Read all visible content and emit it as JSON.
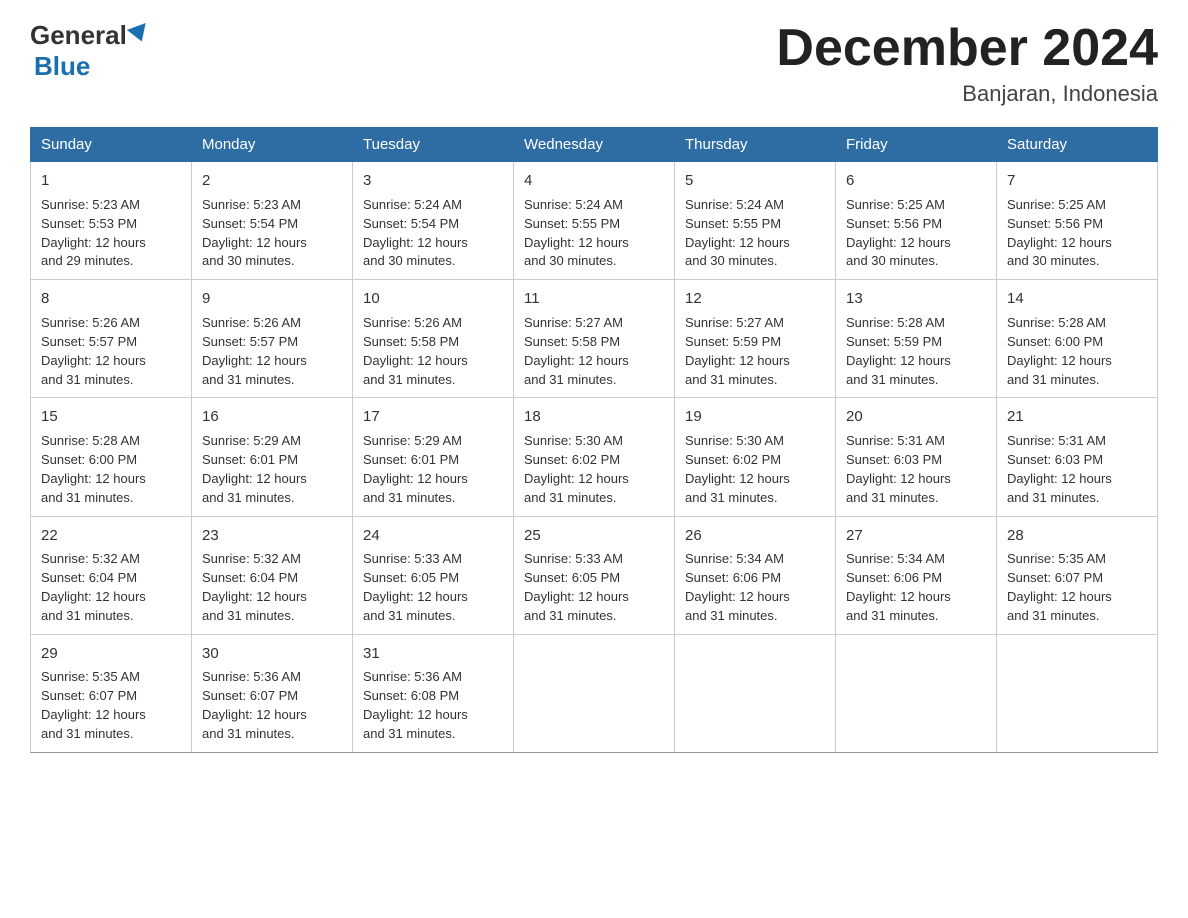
{
  "header": {
    "logo_general": "General",
    "logo_blue": "Blue",
    "month_year": "December 2024",
    "location": "Banjaran, Indonesia"
  },
  "days_of_week": [
    "Sunday",
    "Monday",
    "Tuesday",
    "Wednesday",
    "Thursday",
    "Friday",
    "Saturday"
  ],
  "weeks": [
    [
      {
        "day": "1",
        "lines": [
          "Sunrise: 5:23 AM",
          "Sunset: 5:53 PM",
          "Daylight: 12 hours",
          "and 29 minutes."
        ]
      },
      {
        "day": "2",
        "lines": [
          "Sunrise: 5:23 AM",
          "Sunset: 5:54 PM",
          "Daylight: 12 hours",
          "and 30 minutes."
        ]
      },
      {
        "day": "3",
        "lines": [
          "Sunrise: 5:24 AM",
          "Sunset: 5:54 PM",
          "Daylight: 12 hours",
          "and 30 minutes."
        ]
      },
      {
        "day": "4",
        "lines": [
          "Sunrise: 5:24 AM",
          "Sunset: 5:55 PM",
          "Daylight: 12 hours",
          "and 30 minutes."
        ]
      },
      {
        "day": "5",
        "lines": [
          "Sunrise: 5:24 AM",
          "Sunset: 5:55 PM",
          "Daylight: 12 hours",
          "and 30 minutes."
        ]
      },
      {
        "day": "6",
        "lines": [
          "Sunrise: 5:25 AM",
          "Sunset: 5:56 PM",
          "Daylight: 12 hours",
          "and 30 minutes."
        ]
      },
      {
        "day": "7",
        "lines": [
          "Sunrise: 5:25 AM",
          "Sunset: 5:56 PM",
          "Daylight: 12 hours",
          "and 30 minutes."
        ]
      }
    ],
    [
      {
        "day": "8",
        "lines": [
          "Sunrise: 5:26 AM",
          "Sunset: 5:57 PM",
          "Daylight: 12 hours",
          "and 31 minutes."
        ]
      },
      {
        "day": "9",
        "lines": [
          "Sunrise: 5:26 AM",
          "Sunset: 5:57 PM",
          "Daylight: 12 hours",
          "and 31 minutes."
        ]
      },
      {
        "day": "10",
        "lines": [
          "Sunrise: 5:26 AM",
          "Sunset: 5:58 PM",
          "Daylight: 12 hours",
          "and 31 minutes."
        ]
      },
      {
        "day": "11",
        "lines": [
          "Sunrise: 5:27 AM",
          "Sunset: 5:58 PM",
          "Daylight: 12 hours",
          "and 31 minutes."
        ]
      },
      {
        "day": "12",
        "lines": [
          "Sunrise: 5:27 AM",
          "Sunset: 5:59 PM",
          "Daylight: 12 hours",
          "and 31 minutes."
        ]
      },
      {
        "day": "13",
        "lines": [
          "Sunrise: 5:28 AM",
          "Sunset: 5:59 PM",
          "Daylight: 12 hours",
          "and 31 minutes."
        ]
      },
      {
        "day": "14",
        "lines": [
          "Sunrise: 5:28 AM",
          "Sunset: 6:00 PM",
          "Daylight: 12 hours",
          "and 31 minutes."
        ]
      }
    ],
    [
      {
        "day": "15",
        "lines": [
          "Sunrise: 5:28 AM",
          "Sunset: 6:00 PM",
          "Daylight: 12 hours",
          "and 31 minutes."
        ]
      },
      {
        "day": "16",
        "lines": [
          "Sunrise: 5:29 AM",
          "Sunset: 6:01 PM",
          "Daylight: 12 hours",
          "and 31 minutes."
        ]
      },
      {
        "day": "17",
        "lines": [
          "Sunrise: 5:29 AM",
          "Sunset: 6:01 PM",
          "Daylight: 12 hours",
          "and 31 minutes."
        ]
      },
      {
        "day": "18",
        "lines": [
          "Sunrise: 5:30 AM",
          "Sunset: 6:02 PM",
          "Daylight: 12 hours",
          "and 31 minutes."
        ]
      },
      {
        "day": "19",
        "lines": [
          "Sunrise: 5:30 AM",
          "Sunset: 6:02 PM",
          "Daylight: 12 hours",
          "and 31 minutes."
        ]
      },
      {
        "day": "20",
        "lines": [
          "Sunrise: 5:31 AM",
          "Sunset: 6:03 PM",
          "Daylight: 12 hours",
          "and 31 minutes."
        ]
      },
      {
        "day": "21",
        "lines": [
          "Sunrise: 5:31 AM",
          "Sunset: 6:03 PM",
          "Daylight: 12 hours",
          "and 31 minutes."
        ]
      }
    ],
    [
      {
        "day": "22",
        "lines": [
          "Sunrise: 5:32 AM",
          "Sunset: 6:04 PM",
          "Daylight: 12 hours",
          "and 31 minutes."
        ]
      },
      {
        "day": "23",
        "lines": [
          "Sunrise: 5:32 AM",
          "Sunset: 6:04 PM",
          "Daylight: 12 hours",
          "and 31 minutes."
        ]
      },
      {
        "day": "24",
        "lines": [
          "Sunrise: 5:33 AM",
          "Sunset: 6:05 PM",
          "Daylight: 12 hours",
          "and 31 minutes."
        ]
      },
      {
        "day": "25",
        "lines": [
          "Sunrise: 5:33 AM",
          "Sunset: 6:05 PM",
          "Daylight: 12 hours",
          "and 31 minutes."
        ]
      },
      {
        "day": "26",
        "lines": [
          "Sunrise: 5:34 AM",
          "Sunset: 6:06 PM",
          "Daylight: 12 hours",
          "and 31 minutes."
        ]
      },
      {
        "day": "27",
        "lines": [
          "Sunrise: 5:34 AM",
          "Sunset: 6:06 PM",
          "Daylight: 12 hours",
          "and 31 minutes."
        ]
      },
      {
        "day": "28",
        "lines": [
          "Sunrise: 5:35 AM",
          "Sunset: 6:07 PM",
          "Daylight: 12 hours",
          "and 31 minutes."
        ]
      }
    ],
    [
      {
        "day": "29",
        "lines": [
          "Sunrise: 5:35 AM",
          "Sunset: 6:07 PM",
          "Daylight: 12 hours",
          "and 31 minutes."
        ]
      },
      {
        "day": "30",
        "lines": [
          "Sunrise: 5:36 AM",
          "Sunset: 6:07 PM",
          "Daylight: 12 hours",
          "and 31 minutes."
        ]
      },
      {
        "day": "31",
        "lines": [
          "Sunrise: 5:36 AM",
          "Sunset: 6:08 PM",
          "Daylight: 12 hours",
          "and 31 minutes."
        ]
      },
      {
        "day": "",
        "lines": []
      },
      {
        "day": "",
        "lines": []
      },
      {
        "day": "",
        "lines": []
      },
      {
        "day": "",
        "lines": []
      }
    ]
  ]
}
